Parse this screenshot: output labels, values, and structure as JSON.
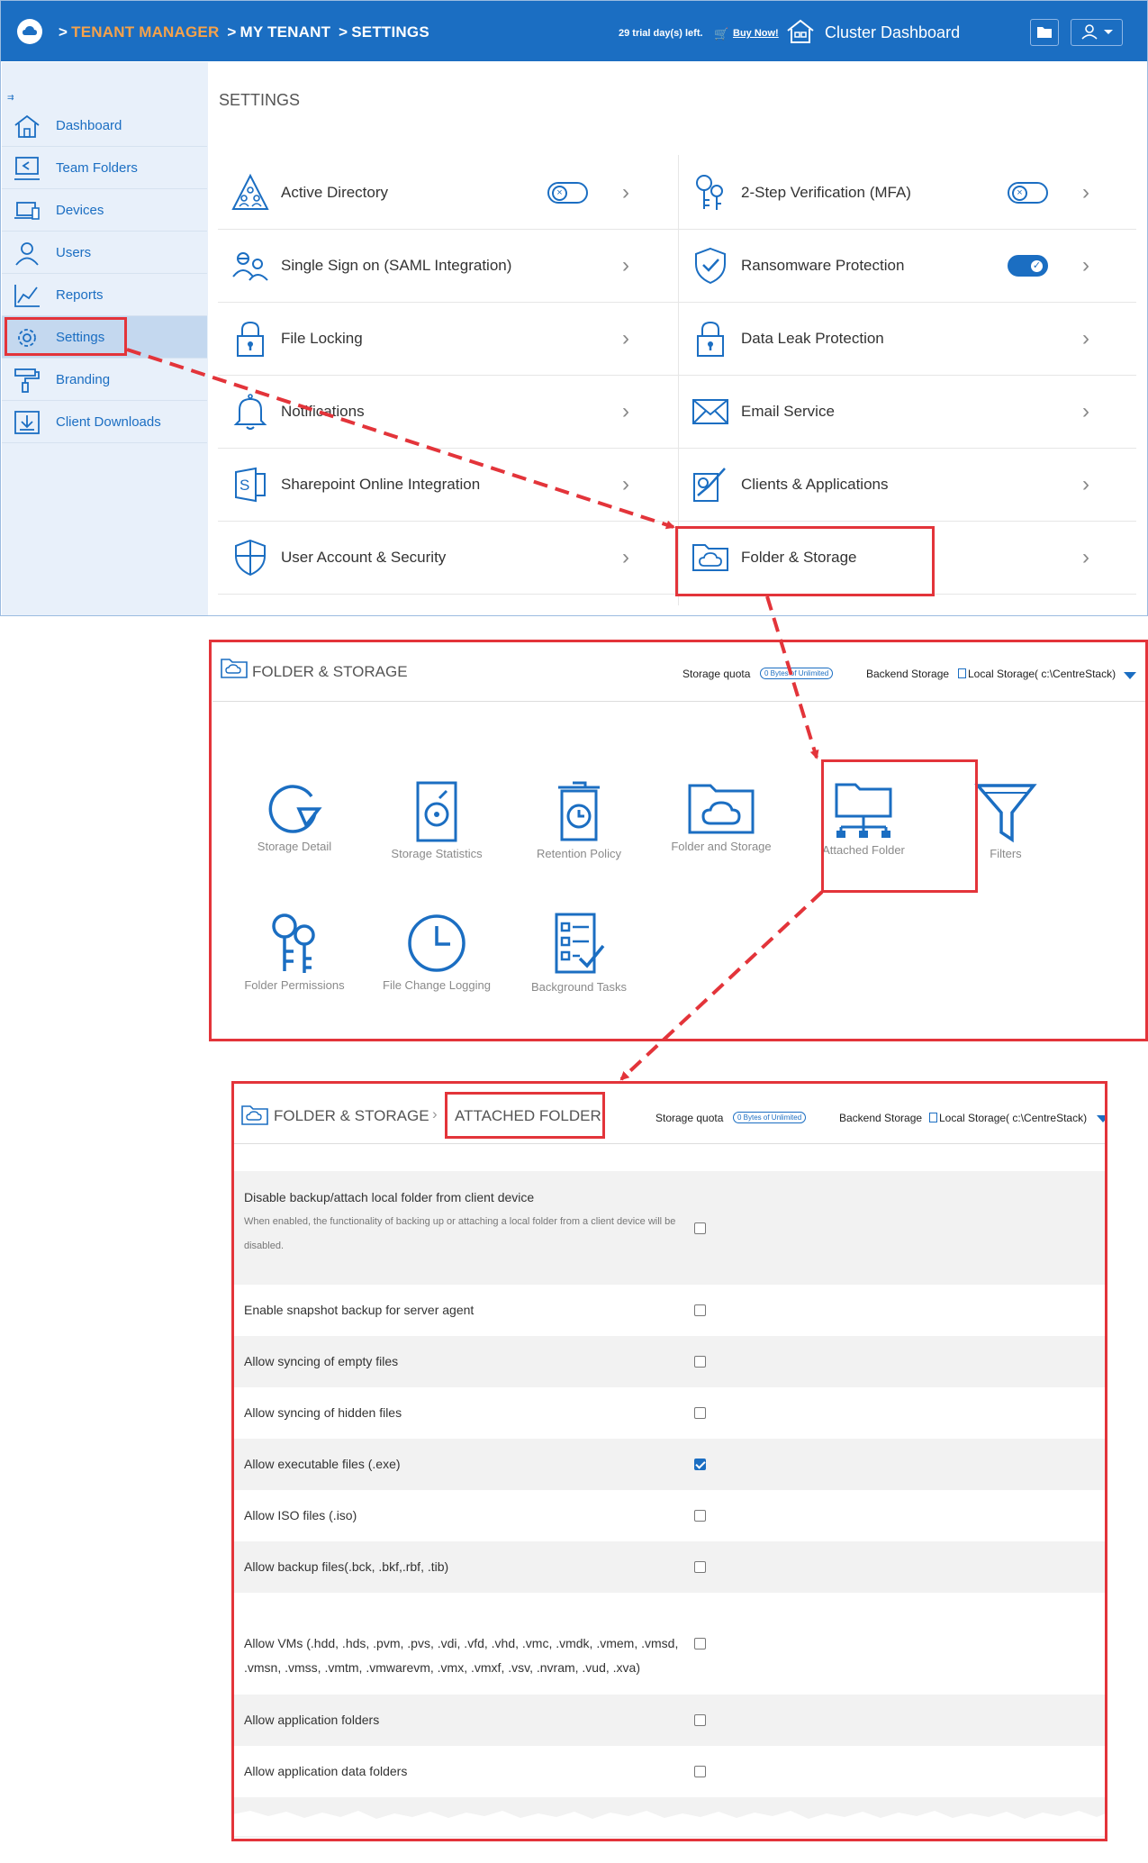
{
  "header": {
    "breadcrumb": [
      "TENANT MANAGER",
      "MY TENANT",
      "SETTINGS"
    ],
    "breadcrumb_sep": ">",
    "trial_text": "29 trial day(s) left.",
    "buy_now": "Buy Now!",
    "cluster_dashboard": "Cluster Dashboard",
    "colors": {
      "bar": "#1b6ec2",
      "breadcrumb_first": "#f6a24a"
    }
  },
  "sidebar": {
    "items": [
      {
        "label": "Dashboard",
        "icon": "home-icon"
      },
      {
        "label": "Team Folders",
        "icon": "team-folders-icon"
      },
      {
        "label": "Devices",
        "icon": "devices-icon"
      },
      {
        "label": "Users",
        "icon": "users-icon"
      },
      {
        "label": "Reports",
        "icon": "reports-icon"
      },
      {
        "label": "Settings",
        "icon": "gear-icon",
        "active": true
      },
      {
        "label": "Branding",
        "icon": "paint-roller-icon"
      },
      {
        "label": "Client Downloads",
        "icon": "download-icon"
      }
    ]
  },
  "settings": {
    "title": "SETTINGS",
    "left": [
      {
        "label": "Active Directory",
        "toggle": "off"
      },
      {
        "label": "Single Sign on (SAML Integration)"
      },
      {
        "label": "File Locking"
      },
      {
        "label": "Notifications"
      },
      {
        "label": "Sharepoint Online Integration"
      },
      {
        "label": "User Account & Security"
      }
    ],
    "right": [
      {
        "label": "2-Step Verification (MFA)",
        "toggle": "off"
      },
      {
        "label": "Ransomware Protection",
        "toggle": "on"
      },
      {
        "label": "Data Leak Protection"
      },
      {
        "label": "Email Service"
      },
      {
        "label": "Clients & Applications"
      },
      {
        "label": "Folder & Storage"
      }
    ]
  },
  "folder_storage": {
    "title": "FOLDER & STORAGE",
    "storage_quota_label": "Storage quota",
    "storage_quota_value": "0 Bytes of Unlimited",
    "backend_label": "Backend Storage",
    "backend_value": "Local Storage( c:\\CentreStack)",
    "tiles": [
      "Storage Detail",
      "Storage Statistics",
      "Retention Policy",
      "Folder and Storage",
      "Attached Folder",
      "Filters",
      "Folder Permissions",
      "File Change Logging",
      "Background Tasks"
    ]
  },
  "attached_folder": {
    "crumb_parent": "FOLDER & STORAGE",
    "crumb_current": "ATTACHED FOLDER",
    "storage_quota_label": "Storage quota",
    "storage_quota_value": "0 Bytes of Unlimited",
    "backend_label": "Backend Storage",
    "backend_value": "Local Storage( c:\\CentreStack)",
    "options": [
      {
        "label": "Disable backup/attach local folder from client device",
        "desc": "When enabled, the functionality of backing up or attaching a local folder from a client device will be disabled.",
        "checked": false
      },
      {
        "label": "Enable snapshot backup for server agent",
        "checked": false
      },
      {
        "label": "Allow syncing of empty files",
        "checked": false
      },
      {
        "label": "Allow syncing of hidden files",
        "checked": false
      },
      {
        "label": "Allow executable files (.exe)",
        "checked": true
      },
      {
        "label": "Allow ISO files (.iso)",
        "checked": false
      },
      {
        "label": "Allow backup files(.bck, .bkf,.rbf, .tib)",
        "checked": false
      },
      {
        "label": "Allow VMs (.hdd, .hds, .pvm, .pvs, .vdi, .vfd, .vhd, .vmc, .vmdk, .vmem, .vmsd, .vmsn, .vmss, .vmtm, .vmwarevm, .vmx, .vmxf, .vsv, .nvram, .vud, .xva)",
        "checked": false
      },
      {
        "label": "Allow application folders",
        "checked": false
      },
      {
        "label": "Allow application data folders",
        "checked": false
      }
    ]
  }
}
